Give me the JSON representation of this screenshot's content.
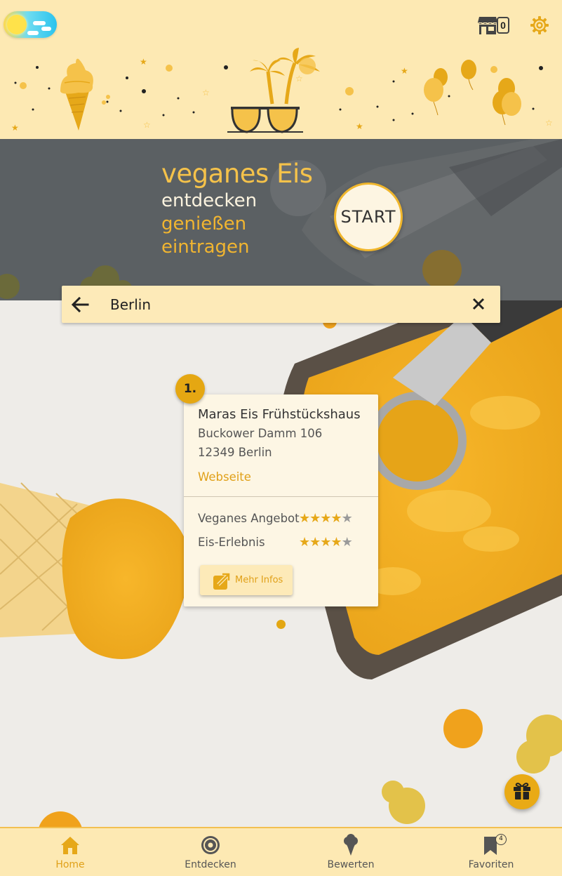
{
  "colors": {
    "accent": "#e6a819",
    "header_bg": "#fde9b3",
    "card_bg": "#fdf6e4",
    "hero_bg": "#5b6063",
    "star_off": "#9a9a9a"
  },
  "header": {
    "theme_toggle_icon": "day-night-toggle-icon",
    "shop_icon": "shop-icon",
    "shop_count": "0",
    "settings_icon": "gear-icon"
  },
  "hero": {
    "title": "veganes Eis",
    "line1": "entdecken",
    "line2": "genießen",
    "line3": "eintragen",
    "start_label": "START"
  },
  "search": {
    "back_icon": "arrow-left-icon",
    "query": "Berlin",
    "clear_icon": "close-icon"
  },
  "result": {
    "rank": "1.",
    "name": "Maras Eis Frühstückshaus",
    "street": "Buckower Damm 106",
    "city": "12349 Berlin",
    "website_label": "Webseite",
    "ratings": [
      {
        "label": "Veganes Angebot",
        "stars": 4,
        "max": 5
      },
      {
        "label": "Eis-Erlebnis",
        "stars": 4,
        "max": 5
      }
    ],
    "more_button": {
      "icon": "external-link-icon",
      "label": "Mehr Infos"
    }
  },
  "carousel": {
    "pages": 1,
    "current": 1
  },
  "fab": {
    "icon": "gift-icon"
  },
  "bottom_nav": [
    {
      "label": "Home",
      "icon": "home-icon",
      "active": true
    },
    {
      "label": "Entdecken",
      "icon": "compass-icon",
      "active": false
    },
    {
      "label": "Bewerten",
      "icon": "ice-cream-icon",
      "active": false
    },
    {
      "label": "Favoriten",
      "icon": "bookmark-icon",
      "active": false,
      "badge": "4"
    }
  ]
}
